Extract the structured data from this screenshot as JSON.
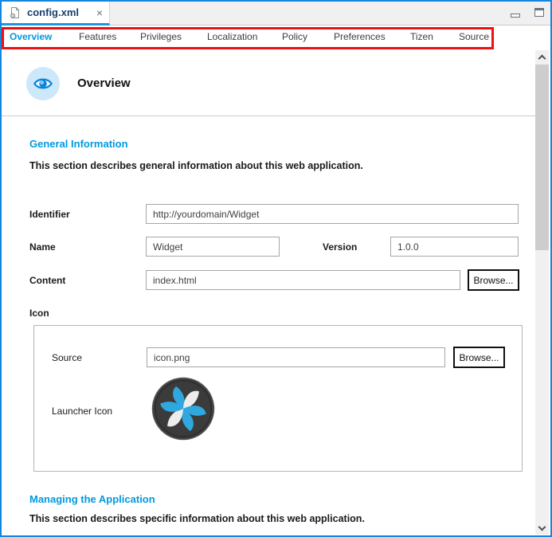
{
  "colors": {
    "frame_blue": "#1287e0",
    "heading_blue": "#0099e0",
    "highlight_red": "#ee1111",
    "tab_underline_blue": "#1d97e4"
  },
  "editor": {
    "tab_title": "config.xml",
    "close_glyph": "×",
    "file_icon": "xml-config-file-icon"
  },
  "window_controls": {
    "minimize_icon": "minimize-icon",
    "maximize_icon": "maximize-icon"
  },
  "nav_tabs": [
    {
      "label": "Overview",
      "active": true
    },
    {
      "label": "Features",
      "active": false
    },
    {
      "label": "Privileges",
      "active": false
    },
    {
      "label": "Localization",
      "active": false
    },
    {
      "label": "Policy",
      "active": false
    },
    {
      "label": "Preferences",
      "active": false
    },
    {
      "label": "Tizen",
      "active": false
    },
    {
      "label": "Source",
      "active": false
    }
  ],
  "page": {
    "title": "Overview",
    "title_icon": "eye-icon"
  },
  "general": {
    "heading": "General Information",
    "description": "This section describes general information about this web application.",
    "identifier": {
      "label": "Identifier",
      "value": "http://yourdomain/Widget"
    },
    "name": {
      "label": "Name",
      "value": "Widget"
    },
    "version": {
      "label": "Version",
      "value": "1.0.0"
    },
    "content": {
      "label": "Content",
      "value": "index.html",
      "browse_label": "Browse..."
    },
    "icon_group": {
      "label": "Icon",
      "source": {
        "label": "Source",
        "value": "icon.png",
        "browse_label": "Browse..."
      },
      "launcher": {
        "label": "Launcher Icon",
        "icon_name": "tizen-pinwheel-icon"
      }
    }
  },
  "managing": {
    "heading": "Managing the Application",
    "description": "This section describes specific information about this web application."
  }
}
